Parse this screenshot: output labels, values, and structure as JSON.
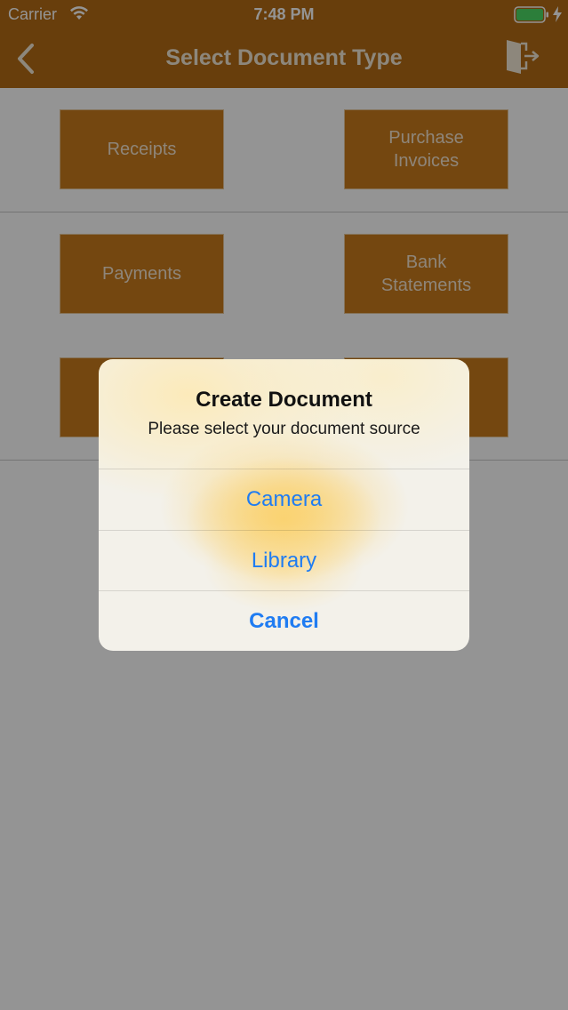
{
  "status_bar": {
    "carrier": "Carrier",
    "time": "7:48 PM"
  },
  "nav": {
    "title": "Select Document Type",
    "back_icon": "chevron-left-icon",
    "logout_icon": "logout-door-icon"
  },
  "tiles": {
    "row1": [
      "Receipts",
      "Purchase\nInvoices"
    ],
    "row2": [
      "Payments",
      "Bank\nStatements"
    ]
  },
  "alert": {
    "title": "Create Document",
    "message": "Please select your document source",
    "actions": {
      "camera": "Camera",
      "library": "Library",
      "cancel": "Cancel"
    }
  },
  "colors": {
    "brand": "#b36c16",
    "tile": "#c97a1c",
    "action": "#1f7cf2"
  }
}
